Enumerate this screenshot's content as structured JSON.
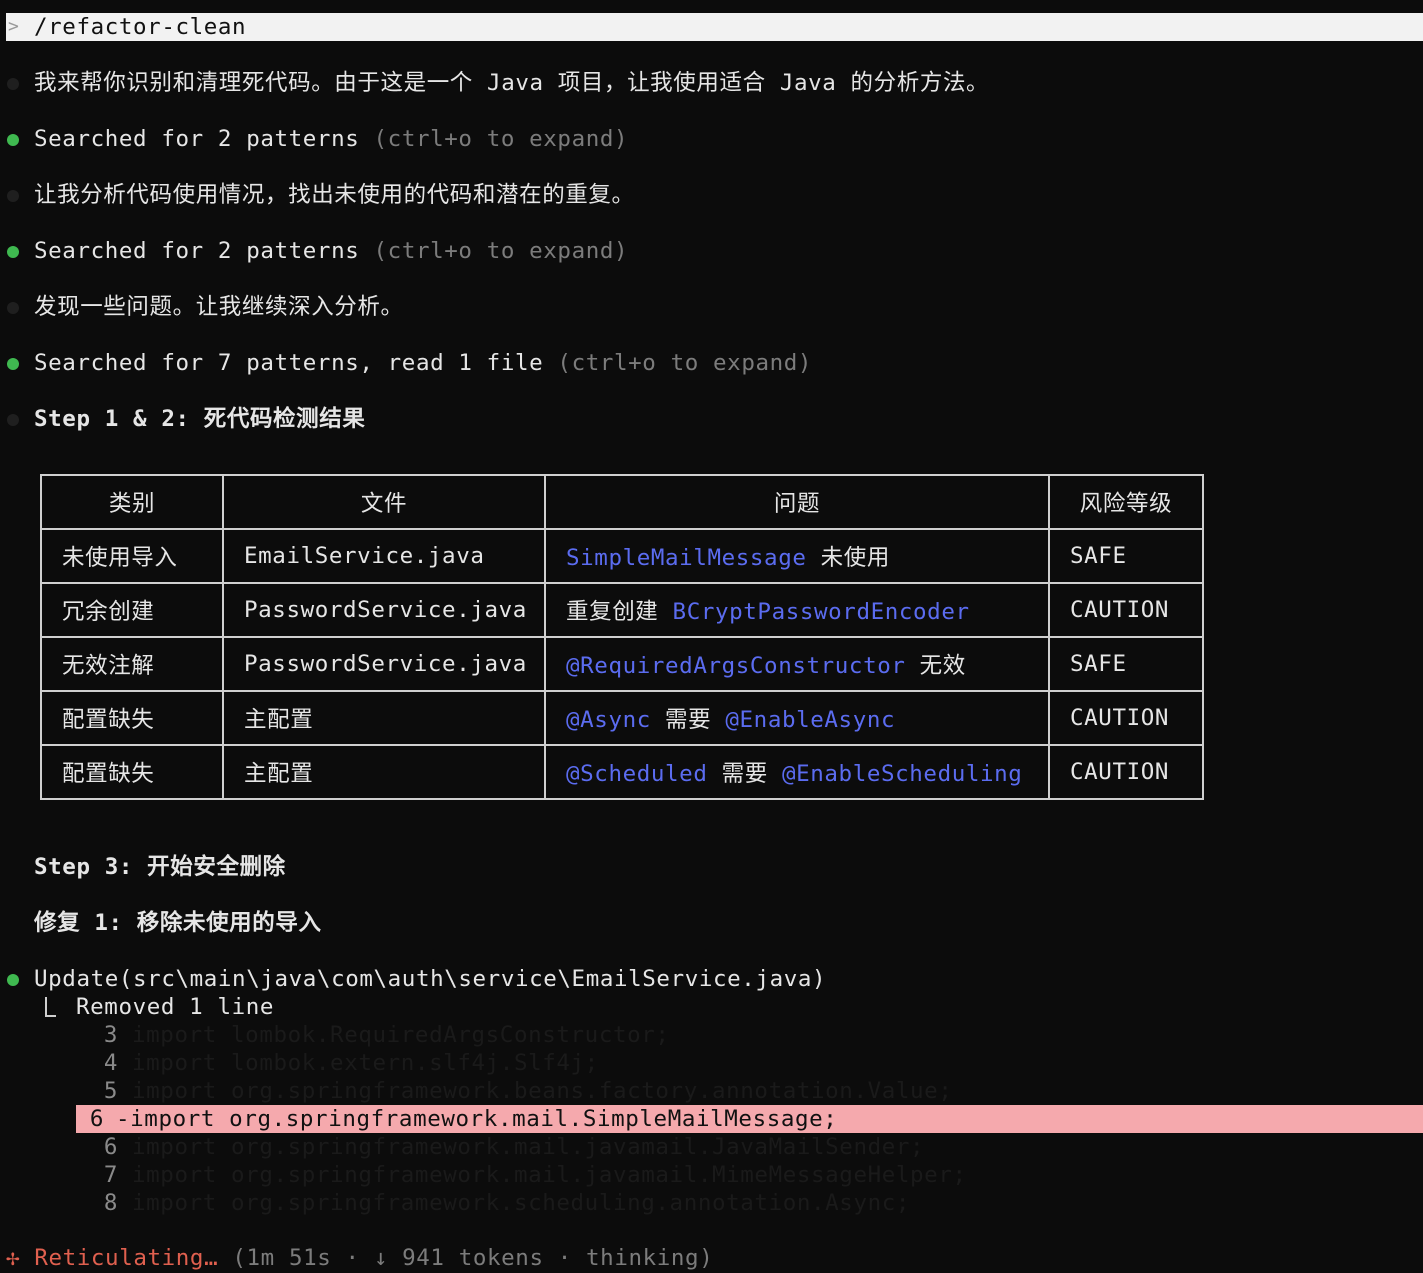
{
  "prompt": {
    "caret": ">",
    "command": "/refactor-clean"
  },
  "messages": [
    {
      "kind": "text",
      "text": "我来帮你识别和清理死代码。由于这是一个 Java 项目，让我使用适合 Java 的分析方法。"
    },
    {
      "kind": "tool",
      "main": "Searched for 2 patterns",
      "hint": "(ctrl+o to expand)"
    },
    {
      "kind": "text",
      "text": "让我分析代码使用情况，找出未使用的代码和潜在的重复。"
    },
    {
      "kind": "tool",
      "main": "Searched for 2 patterns",
      "hint": "(ctrl+o to expand)"
    },
    {
      "kind": "text",
      "text": "发现一些问题。让我继续深入分析。"
    },
    {
      "kind": "tool",
      "main": "Searched for 7 patterns, read 1 file",
      "hint": "(ctrl+o to expand)"
    },
    {
      "kind": "text",
      "text": "Step 1 & 2: 死代码检测结果"
    }
  ],
  "table": {
    "headers": [
      "类别",
      "文件",
      "问题",
      "风险等级"
    ],
    "rows": [
      {
        "category": "未使用导入",
        "file": "EmailService.java",
        "issue_code": "SimpleMailMessage",
        "issue_text": " 未使用",
        "issue_code2": "",
        "risk": "SAFE"
      },
      {
        "category": "冗余创建",
        "file": "PasswordService.java",
        "issue_pre": "重复创建 ",
        "issue_code": "BCryptPasswordEncoder",
        "risk": "CAUTION"
      },
      {
        "category": "无效注解",
        "file": "PasswordService.java",
        "issue_code": "@RequiredArgsConstructor",
        "issue_text": " 无效",
        "risk": "SAFE"
      },
      {
        "category": "配置缺失",
        "file": "主配置",
        "issue_code": "@Async",
        "issue_text": " 需要 ",
        "issue_code2": "@EnableAsync",
        "risk": "CAUTION"
      },
      {
        "category": "配置缺失",
        "file": "主配置",
        "issue_code": "@Scheduled",
        "issue_text": " 需要 ",
        "issue_code2": "@EnableScheduling",
        "risk": "CAUTION"
      }
    ]
  },
  "step3": "Step 3: 开始安全删除",
  "fix1": "修复 1: 移除未使用的导入",
  "update": {
    "title": "Update(src\\main\\java\\com\\auth\\service\\EmailService.java)",
    "summary": "Removed 1 line",
    "diff": [
      {
        "ln": "3",
        "text": "import lombok.RequiredArgsConstructor;"
      },
      {
        "ln": "4",
        "text": "import lombok.extern.slf4j.Slf4j;"
      },
      {
        "ln": "5",
        "text": "import org.springframework.beans.factory.annotation.Value;"
      },
      {
        "ln": "6",
        "text": "-import org.springframework.mail.SimpleMailMessage;",
        "removed": true
      },
      {
        "ln": "6",
        "text": "import org.springframework.mail.javamail.JavaMailSender;"
      },
      {
        "ln": "7",
        "text": "import org.springframework.mail.javamail.MimeMessageHelper;"
      },
      {
        "ln": "8",
        "text": "import org.springframework.scheduling.annotation.Async;"
      }
    ]
  },
  "status": {
    "spinner": "✢",
    "word": "Reticulating…",
    "meta": "(1m 51s · ↓ 941 tokens · thinking)"
  },
  "colors": {
    "background": "#0c0c0c",
    "bullet_green": "#3fb950",
    "code_link": "#5b6cf0",
    "removed_bg": "#f5a9ad",
    "status_accent": "#e0604f"
  }
}
